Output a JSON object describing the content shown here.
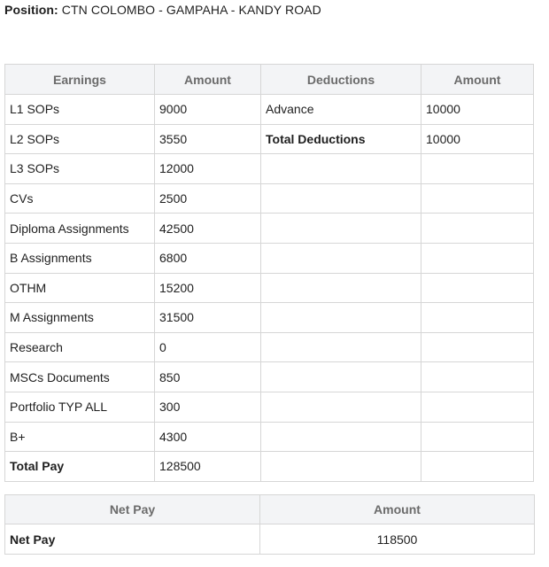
{
  "position": {
    "label": "Position:",
    "value": "CTN COLOMBO - GAMPAHA - KANDY ROAD"
  },
  "payslip": {
    "headers": [
      "Earnings",
      "Amount",
      "Deductions",
      "Amount"
    ],
    "earnings": [
      {
        "label": "L1 SOPs",
        "amount": "9000"
      },
      {
        "label": "L2 SOPs",
        "amount": "3550"
      },
      {
        "label": "L3 SOPs",
        "amount": "12000"
      },
      {
        "label": "CVs",
        "amount": "2500"
      },
      {
        "label": "Diploma Assignments",
        "amount": "42500"
      },
      {
        "label": "B Assignments",
        "amount": "6800"
      },
      {
        "label": "OTHM",
        "amount": "15200"
      },
      {
        "label": "M Assignments",
        "amount": "31500"
      },
      {
        "label": "Research",
        "amount": "0"
      },
      {
        "label": "MSCs Documents",
        "amount": "850"
      },
      {
        "label": "Portfolio TYP ALL",
        "amount": "300"
      },
      {
        "label": "B+",
        "amount": "4300"
      },
      {
        "label": "Total Pay",
        "amount": "128500"
      }
    ],
    "deductions": [
      {
        "label": "Advance",
        "amount": "10000"
      },
      {
        "label": "Total Deductions",
        "amount": "10000"
      }
    ]
  },
  "net_pay": {
    "headers": [
      "Net Pay",
      "Amount"
    ],
    "row": {
      "label": "Net Pay",
      "amount": "118500"
    }
  }
}
